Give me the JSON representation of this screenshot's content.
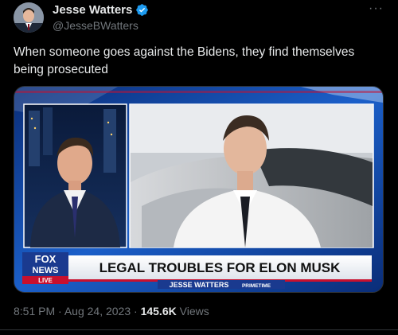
{
  "author": {
    "display_name": "Jesse Watters",
    "handle": "@JesseBWatters",
    "avatar_icon": "avatar",
    "verified_icon": "verified-badge-icon",
    "verified_color": "#1d9bf0"
  },
  "more_label": "···",
  "tweet": {
    "text": "When someone goes against the Bidens, they find themselves being prosecuted"
  },
  "media": {
    "network_logo_top": "FOX",
    "network_logo_bottom": "NEWS",
    "live_label": "LIVE",
    "headline": "LEGAL TROUBLES FOR ELON MUSK",
    "show_name": "JESSE WATTERS",
    "show_tag": "PRIMETIME"
  },
  "footer": {
    "time": "8:51 PM",
    "separator": "·",
    "date": "Aug 24, 2023",
    "views_count": "145.6K",
    "views_label": "Views"
  },
  "colors": {
    "background": "#000000",
    "text_primary": "#e7e9ea",
    "text_secondary": "#71767b",
    "fox_blue": "#1a3a8f",
    "chyron_red": "#c8102e"
  }
}
